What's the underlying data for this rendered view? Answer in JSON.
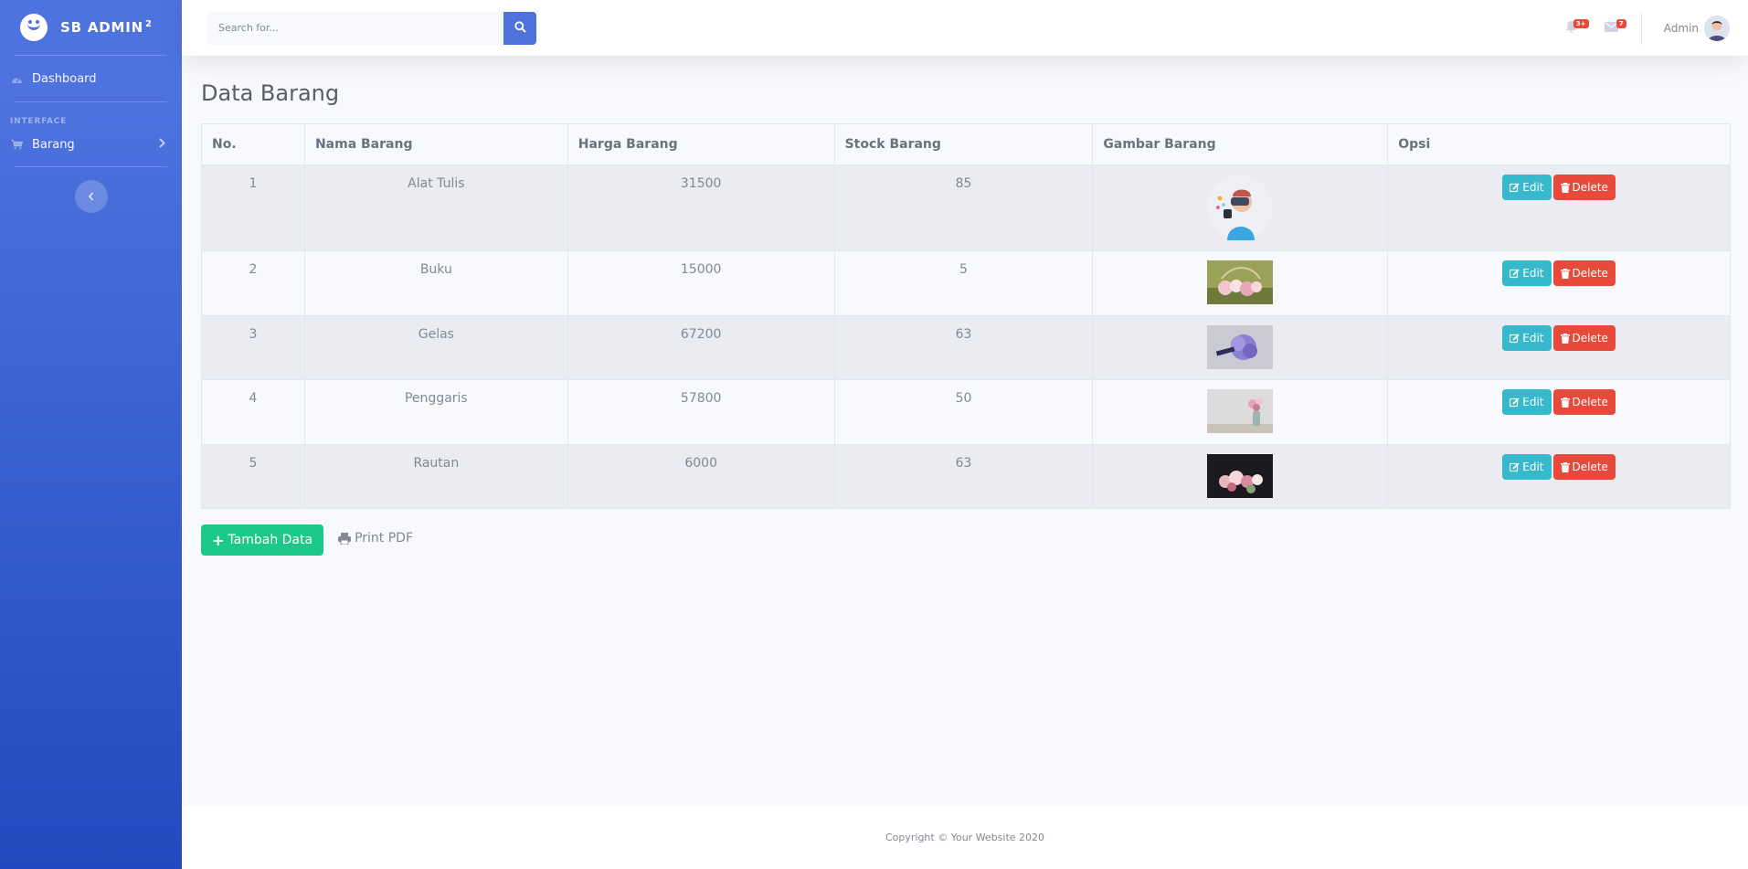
{
  "sidebar": {
    "brand": "SB ADMIN",
    "brand_sup": "2",
    "dashboard_label": "Dashboard",
    "heading": "Interface",
    "barang_label": "Barang",
    "toggle_label": "‹"
  },
  "topbar": {
    "search_placeholder": "Search for...",
    "alerts_badge": "3+",
    "messages_badge": "7",
    "user_name": "Admin"
  },
  "page": {
    "title": "Data Barang"
  },
  "table": {
    "headers": [
      "No.",
      "Nama Barang",
      "Harga Barang",
      "Stock Barang",
      "Gambar Barang",
      "Opsi"
    ],
    "rows": [
      {
        "no": "1",
        "nama": "Alat Tulis",
        "harga": "31500",
        "stock": "85",
        "gambar": "avatar-vr"
      },
      {
        "no": "2",
        "nama": "Buku",
        "harga": "15000",
        "stock": "5",
        "gambar": "flowers-basket"
      },
      {
        "no": "3",
        "nama": "Gelas",
        "harga": "67200",
        "stock": "63",
        "gambar": "purple-bouquet"
      },
      {
        "no": "4",
        "nama": "Penggaris",
        "harga": "57800",
        "stock": "50",
        "gambar": "vase-flowers"
      },
      {
        "no": "5",
        "nama": "Rautan",
        "harga": "6000",
        "stock": "63",
        "gambar": "flowers-dark"
      }
    ],
    "edit_label": "Edit",
    "delete_label": "Delete"
  },
  "actions": {
    "add_label": "Tambah Data",
    "print_label": "Print PDF"
  },
  "footer": {
    "copyright": "Copyright © Your Website 2020"
  },
  "colors": {
    "primary": "#4e73df",
    "info": "#36b9cc",
    "danger": "#e74a3b",
    "success": "#1cc88a"
  }
}
